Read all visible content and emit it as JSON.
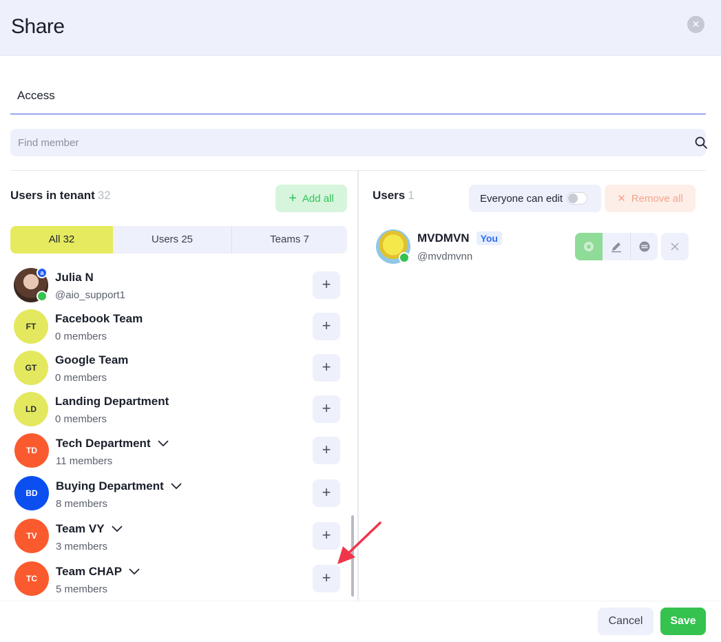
{
  "dialog": {
    "title": "Share",
    "close_icon": "close-icon"
  },
  "tabs": {
    "access_label": "Access"
  },
  "search": {
    "placeholder": "Find member",
    "icon": "search-icon"
  },
  "left_panel": {
    "title": "Users in tenant",
    "count": "32",
    "add_all_label": "Add all",
    "filters": [
      {
        "label": "All 32",
        "active": true
      },
      {
        "label": "Users 25",
        "active": false
      },
      {
        "label": "Teams 7",
        "active": false
      }
    ],
    "members": [
      {
        "name": "Julia N",
        "sub": "@aio_support1",
        "avatar": "photo",
        "initials": "",
        "expandable": false
      },
      {
        "name": "Facebook Team",
        "sub": "0 members",
        "avatar": "yellow",
        "initials": "FT",
        "expandable": false
      },
      {
        "name": "Google Team",
        "sub": "0 members",
        "avatar": "yellow",
        "initials": "GT",
        "expandable": false
      },
      {
        "name": "Landing Department",
        "sub": "0 members",
        "avatar": "yellow",
        "initials": "LD",
        "expandable": false
      },
      {
        "name": "Tech Department",
        "sub": "11 members",
        "avatar": "orange",
        "initials": "TD",
        "expandable": true
      },
      {
        "name": "Buying Department",
        "sub": "8 members",
        "avatar": "blue",
        "initials": "BD",
        "expandable": true
      },
      {
        "name": "Team VY",
        "sub": "3 members",
        "avatar": "orange",
        "initials": "TV",
        "expandable": true
      },
      {
        "name": "Team CHAP",
        "sub": "5 members",
        "avatar": "orange",
        "initials": "TC",
        "expandable": true
      }
    ]
  },
  "right_panel": {
    "title": "Users",
    "count": "1",
    "everyone_can_edit_label": "Everyone can edit",
    "everyone_can_edit_on": false,
    "remove_all_label": "Remove all",
    "users": [
      {
        "name": "MVDMVN",
        "handle": "@mvdmvnn",
        "you_badge": "You"
      }
    ],
    "permission_icons": [
      "eye-icon",
      "pencil-icon",
      "restrict-icon",
      "close-icon"
    ]
  },
  "footer": {
    "cancel_label": "Cancel",
    "save_label": "Save"
  },
  "colors": {
    "accent_green": "#35c24f",
    "active_filter": "#e6ea5f",
    "orange_avatar": "#fb5a2f",
    "blue_avatar": "#0b4ff0",
    "annotation_arrow": "#f0354b"
  }
}
